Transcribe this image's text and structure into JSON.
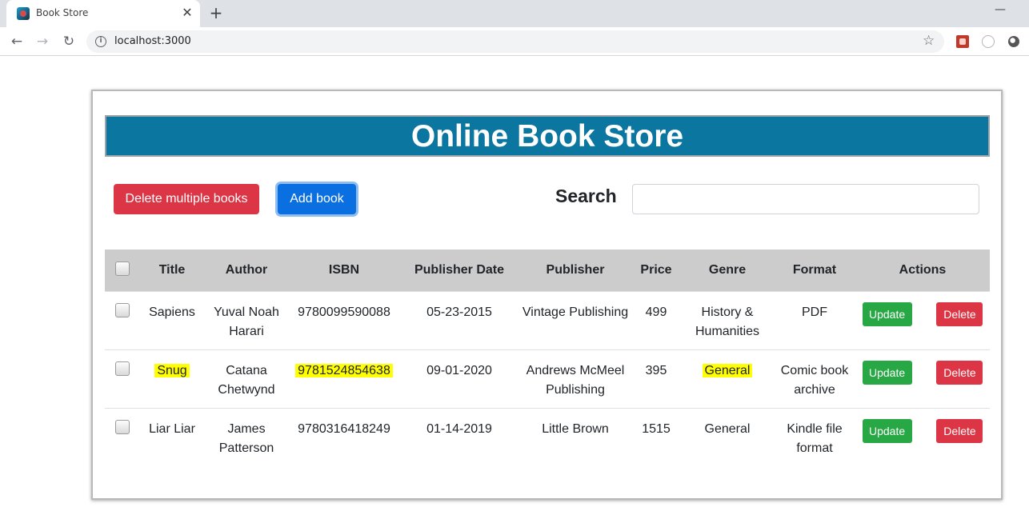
{
  "browser": {
    "tab_title": "Book Store",
    "close_glyph": "✕",
    "newtab_glyph": "+",
    "minimize_glyph": "—",
    "url": "localhost:3000",
    "info_glyph": "i",
    "star_glyph": "☆",
    "back_glyph": "←",
    "forward_glyph": "→",
    "reload_glyph": "↻"
  },
  "header": {
    "title": "Online Book Store"
  },
  "actions": {
    "delete_multiple_label": "Delete multiple books",
    "add_book_label": "Add book"
  },
  "search": {
    "label": "Search",
    "value": "",
    "placeholder": ""
  },
  "table": {
    "columns": [
      "Title",
      "Author",
      "ISBN",
      "Publisher Date",
      "Publisher",
      "Price",
      "Genre",
      "Format",
      "Actions"
    ],
    "update_label": "Update",
    "delete_label": "Delete",
    "rows": [
      {
        "title": "Sapiens",
        "author": "Yuval Noah Harari",
        "isbn": "9780099590088",
        "date": "05-23-2015",
        "publisher": "Vintage Publishing",
        "price": "499",
        "genre": "History & Humanities",
        "format": "PDF"
      },
      {
        "title": "Snug",
        "author": "Catana Chetwynd",
        "isbn": "9781524854638",
        "date": "09-01-2020",
        "publisher": "Andrews McMeel Publishing",
        "price": "395",
        "genre": "General",
        "format": "Comic book archive"
      },
      {
        "title": "Liar Liar",
        "author": "James Patterson",
        "isbn": "9780316418249",
        "date": "01-14-2019",
        "publisher": "Little Brown",
        "price": "1515",
        "genre": "General",
        "format": "Kindle file format"
      }
    ]
  },
  "colors": {
    "banner": "#0b76a0",
    "danger": "#dc3545",
    "primary": "#0a6fe0",
    "success": "#28a745",
    "highlight": "#ffff00",
    "table_header": "#cccccc"
  },
  "icons": [
    "favicon-icon",
    "close-icon",
    "plus-icon",
    "back-arrow-icon",
    "forward-arrow-icon",
    "reload-icon",
    "info-icon",
    "star-icon",
    "extension-icon"
  ]
}
